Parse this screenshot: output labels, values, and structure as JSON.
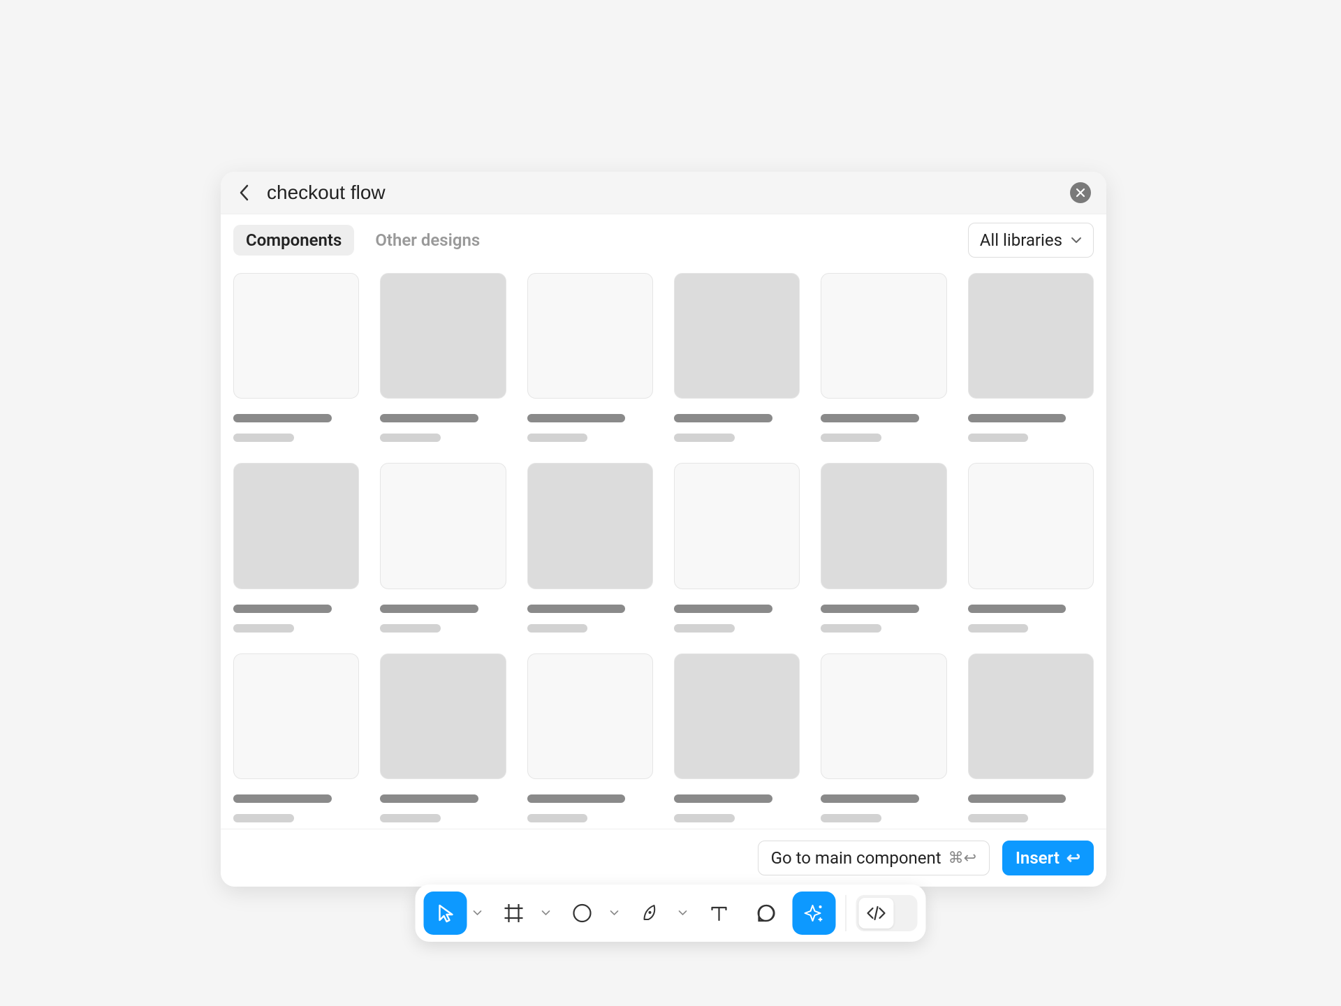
{
  "search": {
    "value": "checkout flow",
    "placeholder": "Search"
  },
  "tabs": {
    "components": "Components",
    "other_designs": "Other designs"
  },
  "libraries_dropdown": "All libraries",
  "actions": {
    "go_to_main": "Go to main component",
    "go_to_main_shortcut": "⌘↩",
    "insert": "Insert",
    "insert_shortcut": "↩"
  },
  "results_grid_shades": [
    "light",
    "dark",
    "light",
    "dark",
    "light",
    "dark",
    "dark",
    "light",
    "dark",
    "light",
    "dark",
    "light",
    "light",
    "dark",
    "light",
    "dark",
    "light",
    "dark"
  ],
  "toolbar": {
    "tools": [
      "move",
      "frame",
      "shape",
      "pen",
      "text",
      "comment",
      "actions"
    ],
    "dev_mode": false
  },
  "colors": {
    "accent": "#0d99ff"
  }
}
